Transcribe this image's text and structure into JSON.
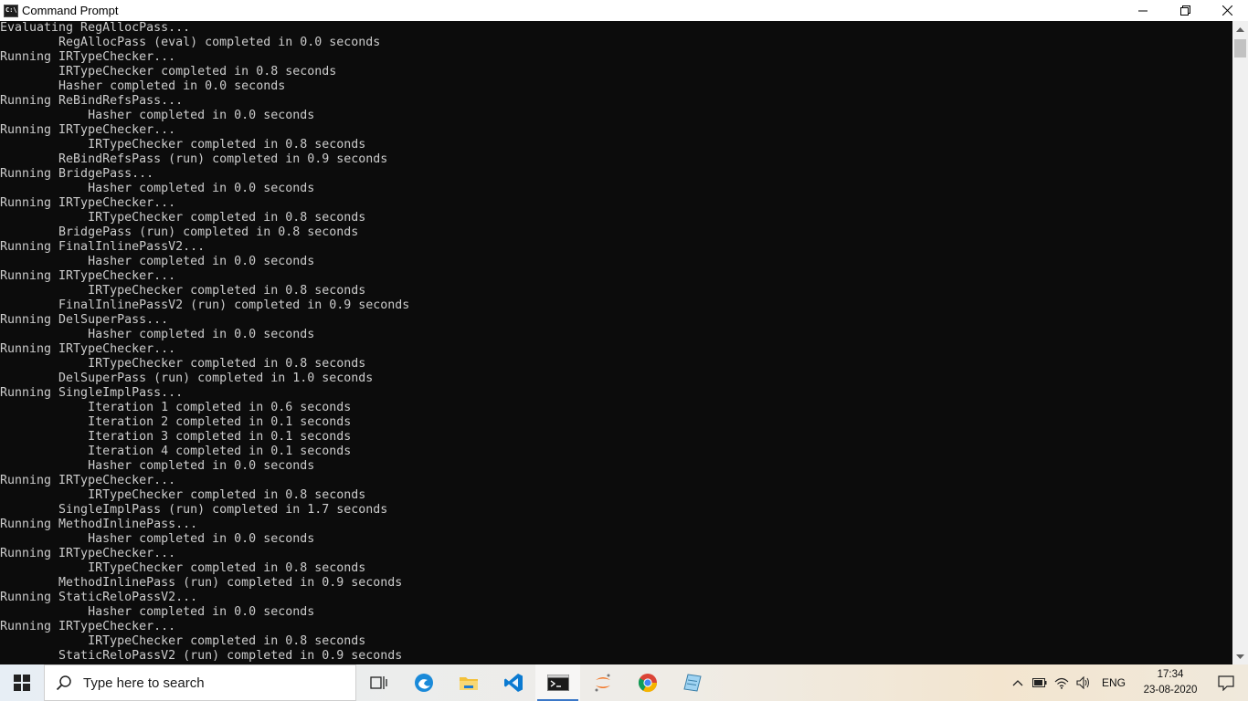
{
  "window": {
    "title": "Command Prompt",
    "minimize_label": "—",
    "maximize_label": "❐",
    "close_label": "✕"
  },
  "console": {
    "lines": [
      "Evaluating RegAllocPass...",
      "        RegAllocPass (eval) completed in 0.0 seconds",
      "Running IRTypeChecker...",
      "        IRTypeChecker completed in 0.8 seconds",
      "        Hasher completed in 0.0 seconds",
      "Running ReBindRefsPass...",
      "            Hasher completed in 0.0 seconds",
      "Running IRTypeChecker...",
      "            IRTypeChecker completed in 0.8 seconds",
      "        ReBindRefsPass (run) completed in 0.9 seconds",
      "Running BridgePass...",
      "            Hasher completed in 0.0 seconds",
      "Running IRTypeChecker...",
      "            IRTypeChecker completed in 0.8 seconds",
      "        BridgePass (run) completed in 0.8 seconds",
      "Running FinalInlinePassV2...",
      "            Hasher completed in 0.0 seconds",
      "Running IRTypeChecker...",
      "            IRTypeChecker completed in 0.8 seconds",
      "        FinalInlinePassV2 (run) completed in 0.9 seconds",
      "Running DelSuperPass...",
      "            Hasher completed in 0.0 seconds",
      "Running IRTypeChecker...",
      "            IRTypeChecker completed in 0.8 seconds",
      "        DelSuperPass (run) completed in 1.0 seconds",
      "Running SingleImplPass...",
      "            Iteration 1 completed in 0.6 seconds",
      "            Iteration 2 completed in 0.1 seconds",
      "            Iteration 3 completed in 0.1 seconds",
      "            Iteration 4 completed in 0.1 seconds",
      "            Hasher completed in 0.0 seconds",
      "Running IRTypeChecker...",
      "            IRTypeChecker completed in 0.8 seconds",
      "        SingleImplPass (run) completed in 1.7 seconds",
      "Running MethodInlinePass...",
      "            Hasher completed in 0.0 seconds",
      "Running IRTypeChecker...",
      "            IRTypeChecker completed in 0.8 seconds",
      "        MethodInlinePass (run) completed in 0.9 seconds",
      "Running StaticReloPassV2...",
      "            Hasher completed in 0.0 seconds",
      "Running IRTypeChecker...",
      "            IRTypeChecker completed in 0.8 seconds",
      "        StaticReloPassV2 (run) completed in 0.9 seconds"
    ]
  },
  "taskbar": {
    "search_placeholder": "Type here to search",
    "apps": [
      "task-view",
      "edge",
      "file-explorer",
      "vscode",
      "command-prompt",
      "jupyter",
      "chrome",
      "notepad"
    ],
    "active_app": "command-prompt",
    "language": "ENG",
    "time": "17:34",
    "date": "23-08-2020"
  },
  "colors": {
    "console_bg": "#0c0c0c",
    "console_text": "#cccccc",
    "titlebar_bg": "#ffffff"
  }
}
